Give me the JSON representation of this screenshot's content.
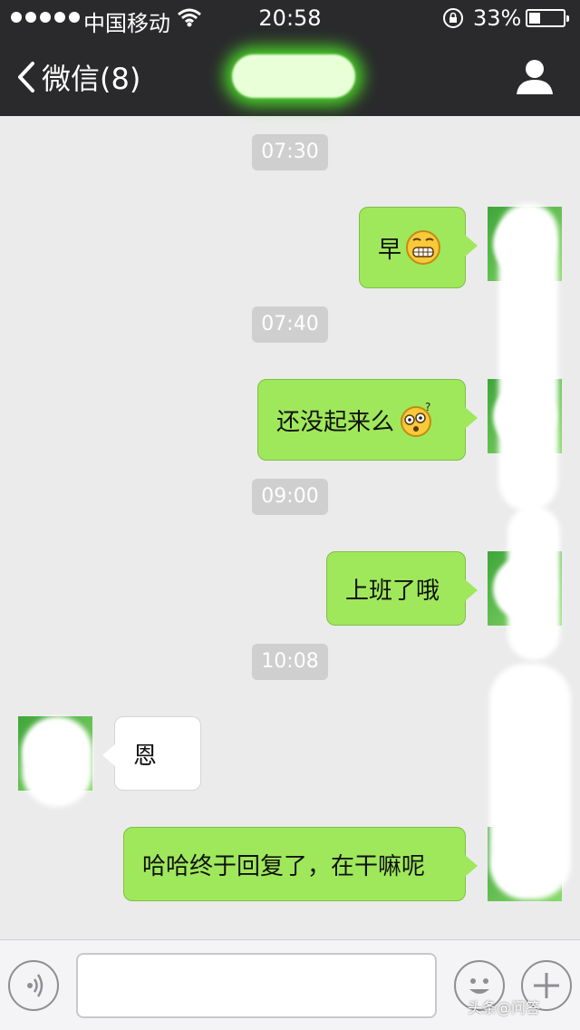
{
  "status_bar": {
    "carrier": "中国移动",
    "time": "20:58",
    "battery": "33%",
    "battery_level": 0.33
  },
  "nav": {
    "back_label": "微信(8)",
    "title": ""
  },
  "chat": {
    "timestamps": [
      "07:30",
      "07:40",
      "09:00",
      "10:08"
    ],
    "messages": [
      {
        "direction": "out",
        "text": "早",
        "emoji": "grin-emoji"
      },
      {
        "direction": "out",
        "text": "还没起来么",
        "emoji": "confused-emoji"
      },
      {
        "direction": "out",
        "text": "上班了哦"
      },
      {
        "direction": "in",
        "text": "恩"
      },
      {
        "direction": "out",
        "text": "哈哈终于回复了，在干嘛呢"
      }
    ]
  },
  "input_bar": {
    "text_value": "",
    "watermark": "头条@问答"
  },
  "colors": {
    "bar": "#2a2a2c",
    "outgoing_bubble": "#9fe85b",
    "chat_background": "#ebebeb"
  }
}
